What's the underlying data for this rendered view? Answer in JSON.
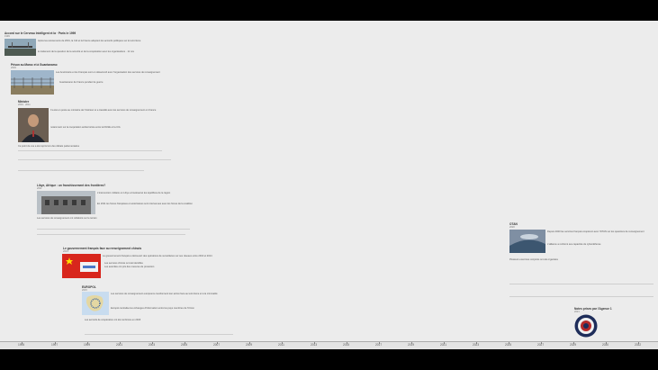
{
  "page": {
    "title": "Accord sur le Cerveau Intelligent et la · Paris le 1999",
    "subtitle": "1999"
  },
  "entries": [
    {
      "heading": "",
      "year": "",
      "text": [
        "Après les évènements de 2001, la CIA et la France adoptent les accords politiques sur le terrorisme",
        "le traitement de la question de la sécurité et de la coopération avec les organisations · 11 nov"
      ]
    },
    {
      "heading": "Prison au Maroc et à Guantanamo",
      "year": "2003",
      "text": [
        "Les Américains et les Français sont en désaccord avec l'organisation des services de renseignement",
        "Guantanamo de France pendant la guerre"
      ]
    },
    {
      "heading": "Ministre",
      "year": "2004 · 2011",
      "text": [
        "Il a été en poste au ministère de l'Intérieur et a travaillé avec les services de renseignement en France",
        "notamment sur la coopération antiterroriste entre la DGSE et la CIA",
        "Ce point de vue a été repris lors des débats parlementaires"
      ]
    },
    {
      "heading": "Libye, Afrique : un franchissement des frontières?",
      "year": "2011",
      "text": [
        "L'intervention militaire en Libye a bouleversé les équilibres de la région",
        "En 2011 les forces françaises et américaines sont intervenues avec les forces de la coalition",
        "Les services de renseignement ont collaboré sur le terrain"
      ]
    },
    {
      "heading": "Le gouvernement français face au renseignement chinois",
      "year": "2013",
      "text": [
        "Le gouvernement français a découvert des opérations de surveillance sur ses réseaux entre 2013 et 2014",
        "Les services chinois ont été identifiés",
        "Les autorités ont pris des mesures de protection"
      ]
    },
    {
      "heading": "EUROPOL",
      "year": "2015",
      "text": [
        "Les services de renseignement européens coordonnent leur action face au terrorisme et à la criminalité",
        "Europol centralise les échanges d'information entre les pays membres de l'Union",
        "Les accords de coopération ont été renforcés en 2015"
      ]
    },
    {
      "heading": "OTAN",
      "year": "2020",
      "text": [
        "Depuis 2020 les services français coopèrent avec l'OTAN sur les questions de renseignement",
        "L'alliance a renforcé ses capacités de cyberdéfense",
        "Plusieurs exercices conjoints ont été organisés"
      ]
    },
    {
      "heading": "Notes prises par l'Agence 1",
      "year": "2021",
      "text": []
    }
  ],
  "axis": {
    "ticks": [
      "1995",
      "1997",
      "1999",
      "2001",
      "2003",
      "2005",
      "2007",
      "2009",
      "2011",
      "2013",
      "2015",
      "2017",
      "2019",
      "2021",
      "2023",
      "2025",
      "2027",
      "2029",
      "2030",
      "2032"
    ]
  }
}
